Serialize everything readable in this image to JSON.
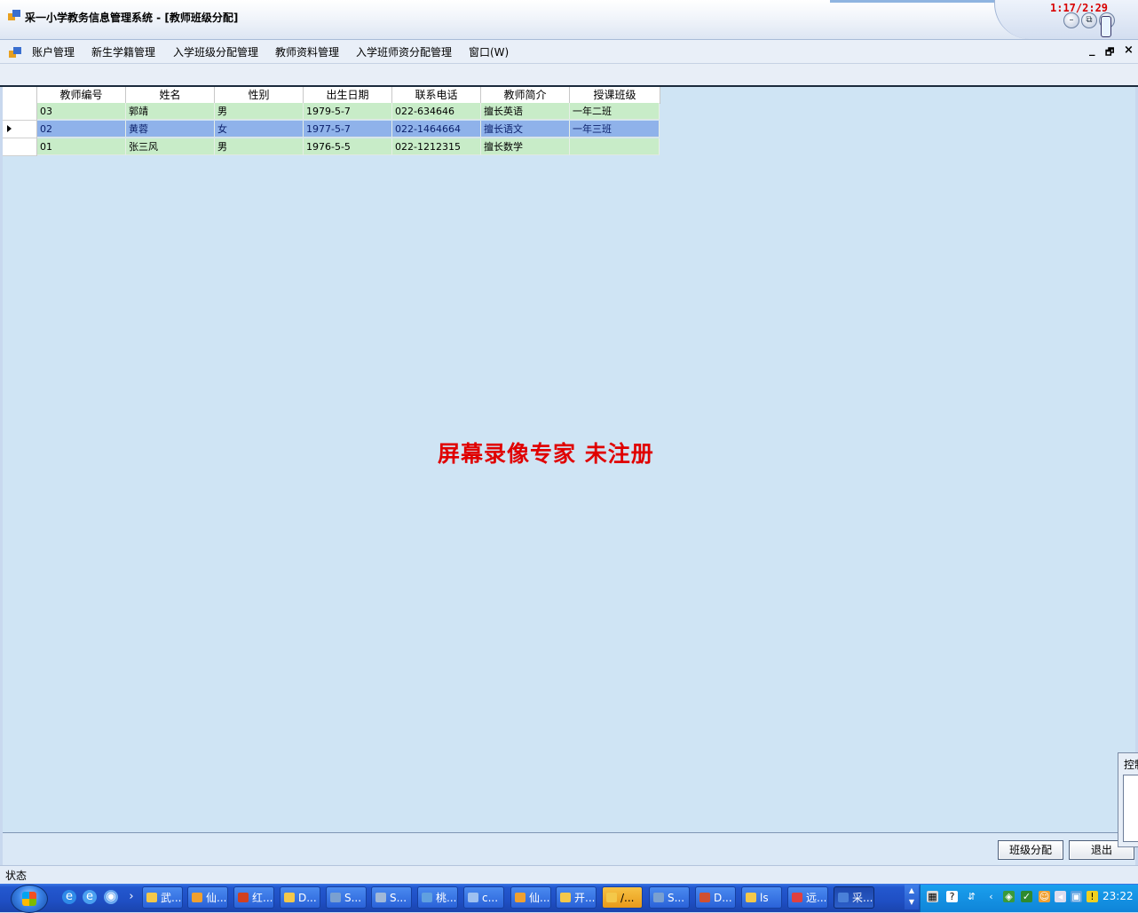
{
  "window": {
    "title": "采一小学教务信息管理系统 - [教师班级分配]",
    "recorder_clock": "1:17/2:29",
    "caption_min": "–",
    "caption_max": "⧉",
    "caption_close": "×"
  },
  "menu": {
    "items": [
      "账户管理",
      "新生学籍管理",
      "入学班级分配管理",
      "教师资料管理",
      "入学班师资分配管理",
      "窗口(W)"
    ],
    "mdi_min": "_",
    "mdi_restore": "🗗",
    "mdi_close": "×"
  },
  "grid": {
    "columns": [
      "教师编号",
      "姓名",
      "性别",
      "出生日期",
      "联系电话",
      "教师简介",
      "授课班级"
    ],
    "rows": [
      [
        "03",
        "郭靖",
        "男",
        "1979-5-7",
        "022-634646",
        "擅长英语",
        "一年二班"
      ],
      [
        "02",
        "黄蓉",
        "女",
        "1977-5-7",
        "022-1464664",
        "擅长语文",
        "一年三班"
      ],
      [
        "01",
        "张三风",
        "男",
        "1976-5-5",
        "022-1212315",
        "擅长数学",
        ""
      ]
    ],
    "selected_row": 1
  },
  "watermark": "屏幕录像专家  未注册",
  "buttons": {
    "assign_class": "班级分配",
    "exit": "退出"
  },
  "status": {
    "text": "状态"
  },
  "side_panel": {
    "title": "控制"
  },
  "taskbar": {
    "tasks": [
      {
        "label": "武...",
        "color": "#f4c84a"
      },
      {
        "label": "仙...",
        "color": "#f0a030"
      },
      {
        "label": "红...",
        "color": "#d04020"
      },
      {
        "label": "D...",
        "color": "#f4c84a"
      },
      {
        "label": "S...",
        "color": "#7aa0d0"
      },
      {
        "label": "S...",
        "color": "#a0b8d8"
      },
      {
        "label": "桃...",
        "color": "#60a0e0"
      },
      {
        "label": "c...",
        "color": "#9ec0f0"
      },
      {
        "label": "仙...",
        "color": "#f0a030"
      },
      {
        "label": "开...",
        "color": "#f4c84a"
      },
      {
        "label": "/...",
        "color": "#f4c84a"
      },
      {
        "label": "S...",
        "color": "#7aa0d0"
      },
      {
        "label": "D...",
        "color": "#d05030"
      },
      {
        "label": "ls",
        "color": "#f4c84a"
      },
      {
        "label": "远...",
        "color": "#e04040"
      },
      {
        "label": "采...",
        "color": "#4a80d8"
      }
    ],
    "clock": "23:22"
  },
  "colors": {
    "grid_row": "#c8ecc8",
    "grid_selected": "#8fb2ea",
    "client_bg": "#cfe4f4",
    "watermark": "#e00000"
  }
}
